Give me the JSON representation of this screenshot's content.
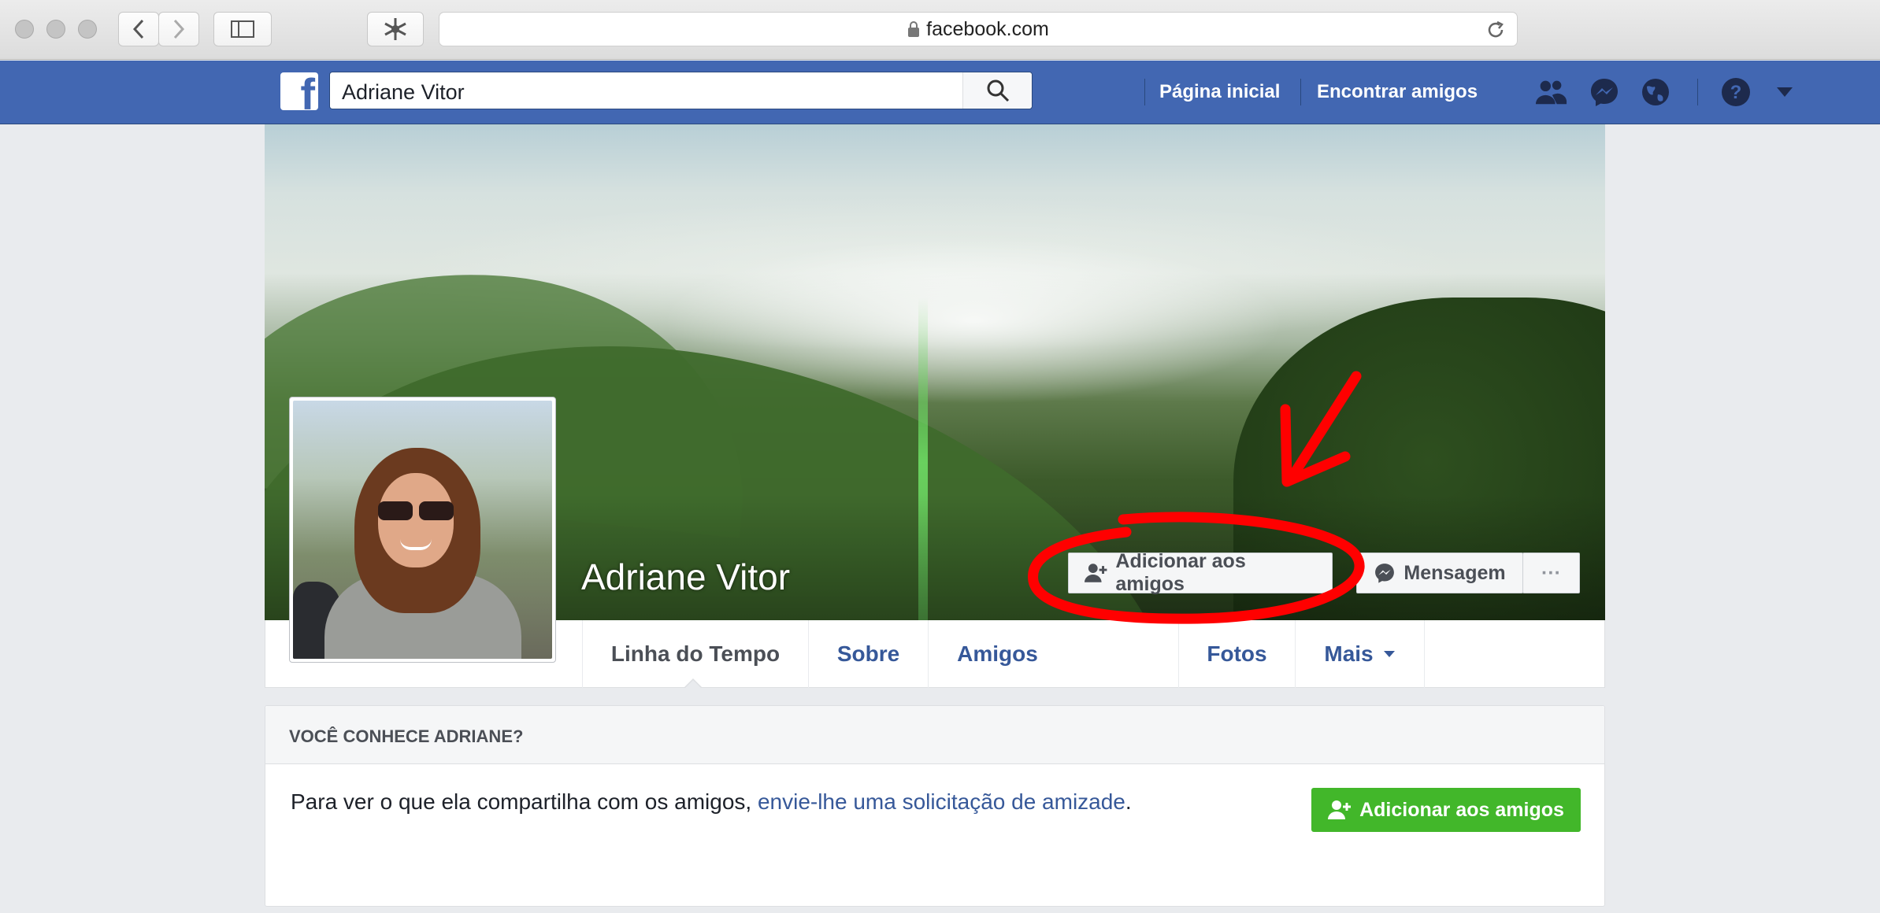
{
  "browser": {
    "url": "facebook.com"
  },
  "header": {
    "search_value": "Adriane Vitor",
    "nav_links": [
      "Página inicial",
      "Encontrar amigos"
    ],
    "brand_color": "#4267b2"
  },
  "profile": {
    "name": "Adriane Vitor",
    "add_friend_label": "Adicionar aos amigos",
    "message_label": "Mensagem",
    "more_label": "···"
  },
  "tabs": [
    "Linha do Tempo",
    "Sobre",
    "Amigos",
    "Fotos",
    "Mais"
  ],
  "know_card": {
    "title": "VOCÊ CONHECE ADRIANE?",
    "text_prefix": "Para ver o que ela compartilha com os amigos, ",
    "link_text": "envie-lhe uma solicitação de amizade",
    "text_suffix": ".",
    "button_label": "Adicionar aos amigos",
    "button_color": "#42b72a"
  },
  "annotation": {
    "color": "#ff0000"
  }
}
